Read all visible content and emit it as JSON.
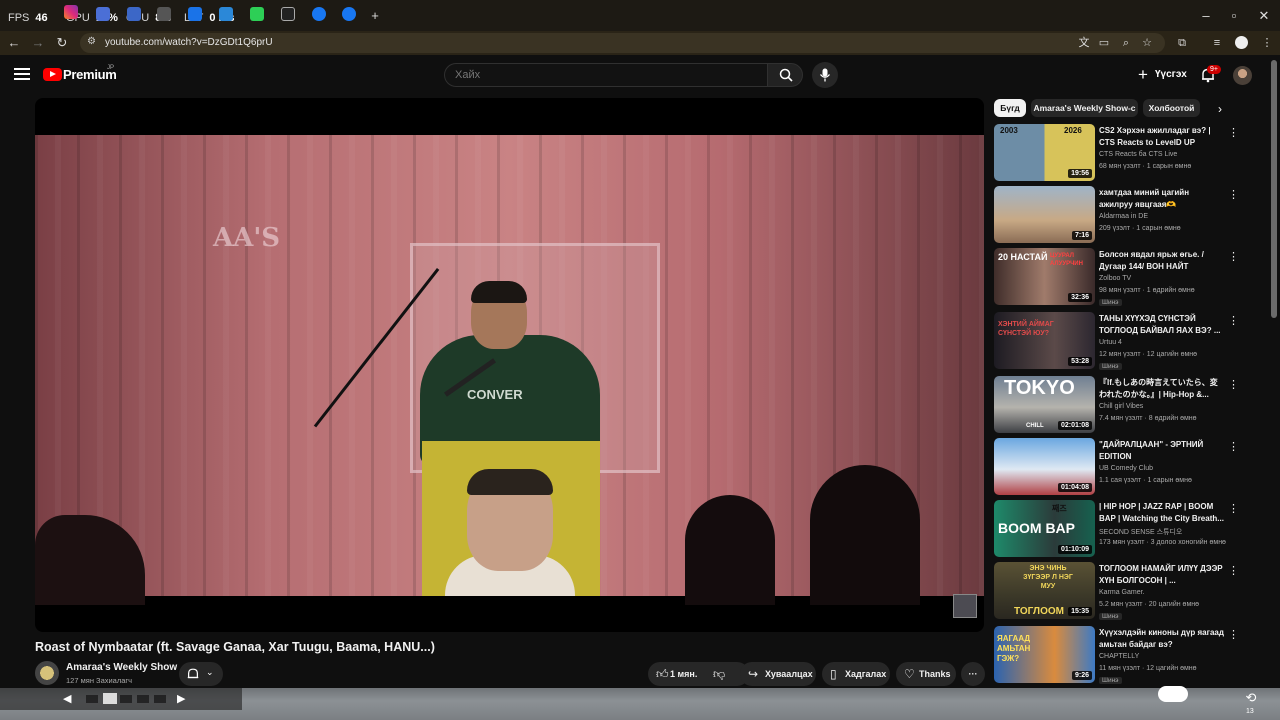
{
  "overlay": {
    "fps_label": "FPS",
    "fps_value": "46",
    "gpu_label": "GPU",
    "gpu_value": "16%",
    "cpu_label": "CPU",
    "cpu_value": "8%",
    "lat_label": "LAT",
    "lat_value": "0 ms"
  },
  "browser": {
    "url": "youtube.com/watch?v=DzGDt1Q6prU"
  },
  "header": {
    "brand": "Premium",
    "region": "JP",
    "search_placeholder": "Хайх",
    "create_label": "Үүсгэх",
    "notif_count": "9+"
  },
  "video": {
    "sign_text": "AA'S",
    "shirt_text": "CONVER",
    "title": "Roast of Nymbaatar (ft. Savage Ganaa, Xar Tuugu, Baama, HANU...)",
    "channel": "Amaraa's Weekly Show",
    "subscribers": "127 мян Захиалагч",
    "likes": "1 мян.",
    "share_label": "Хуваалцах",
    "save_label": "Хадгалах",
    "thanks_label": "Thanks"
  },
  "chips": [
    {
      "label": "Бүгд",
      "active": true
    },
    {
      "label": "Amaraa's Weekly Show-с"
    },
    {
      "label": "Холбоотой"
    }
  ],
  "recommendations": [
    {
      "title": "CS2 Хэрхэн ажилладаг вэ? | CTS Reacts to LevelD UP",
      "channel": "CTS Reacts бa CTS Live",
      "meta": "68 мян үзэлт · 1 сарын өмнө",
      "duration": "19:56",
      "thumb_text_a": "2003",
      "thumb_text_b": "2026"
    },
    {
      "title": "хамтдаа миний цагийн ажилруу явцгаая🫶",
      "channel": "Aldarmaa in DE",
      "meta": "209 үзэлт · 1 сарын өмнө",
      "duration": "7:16"
    },
    {
      "title": "Болсон явдал ярьж өгье. / Дугаар 144/ ВОН НАЙТ",
      "channel": "Zolboo TV",
      "meta": "98 мян үзэлт · 1 өдрийн өмнө",
      "duration": "32:36",
      "badge": "Шинэ",
      "thumb_text_a": "20 НАСТАЙ",
      "thumb_text_b": "ЦУУРАЛ АЛУУРЧИН"
    },
    {
      "title": "ТАНЫ ХҮҮХЭД СҮНСТЭЙ ТОГЛООД БАЙВАЛ ЯАХ ВЭ? ...",
      "channel": "Urtuu 4",
      "meta": "12 мян үзэлт · 12 цагийн өмнө",
      "duration": "53:28",
      "badge": "Шинэ",
      "thumb_text_a": "ХЭНТИЙ АЙМАГ СҮНСТЭЙ ЮУ?"
    },
    {
      "title": "『If.もしあの時言えていたら、変われたのかな。』| Hip-Hop &...",
      "channel": "Chill girl Vibes",
      "meta": "7.4 мян үзэлт · 8 өдрийн өмнө",
      "duration": "02:01:08",
      "thumb_text_a": "TOKYO",
      "thumb_text_b": "CHILL"
    },
    {
      "title": "\"ДАЙРАЛЦААН\" - ЭРТНИЙ EDITION",
      "channel": "UB Comedy Club",
      "meta": "1.1 сая үзэлт · 1 сарын өмнө",
      "duration": "01:04:08"
    },
    {
      "title": "| HIP HOP | JAZZ RAP | BOOM BAP | Watching the City Breath...",
      "channel": "SECOND SENSE 스튜디오",
      "meta": "173 мян үзэлт · 3 долоо хоногийн өмнө",
      "duration": "01:10:09",
      "thumb_text_a": "BOOM BAP",
      "thumb_text_b": "째즈"
    },
    {
      "title": "ТОГЛООМ НАМАЙГ ИЛҮҮ ДЭЭР ХҮН БОЛГОСОН | ...",
      "channel": "Karma Gamer.",
      "meta": "5.2 мян үзэлт · 20 цагийн өмнө",
      "duration": "15:35",
      "badge": "Шинэ",
      "thumb_text_a": "ЭНЭ ЧИНЬ ЗҮГЭЭР Л НЭГ МУУ",
      "thumb_text_b": "ТОГЛООМ"
    },
    {
      "title": "Хүүхэлдэйн киноны дүр яагаад амьтан байдаг вэ?",
      "channel": "CHAPTELLY",
      "meta": "11 мян үзэлт · 12 цагийн өмнө",
      "duration": "9:26",
      "badge": "Шинэ",
      "thumb_text_a": "ЯАГААД АМЬТАН ГЭЖ?"
    }
  ],
  "bottom": {
    "counter": "13"
  },
  "colors": {
    "brand_red": "#ff0000",
    "accent_badge": "#cc0000",
    "bg": "#0f0f0f"
  }
}
